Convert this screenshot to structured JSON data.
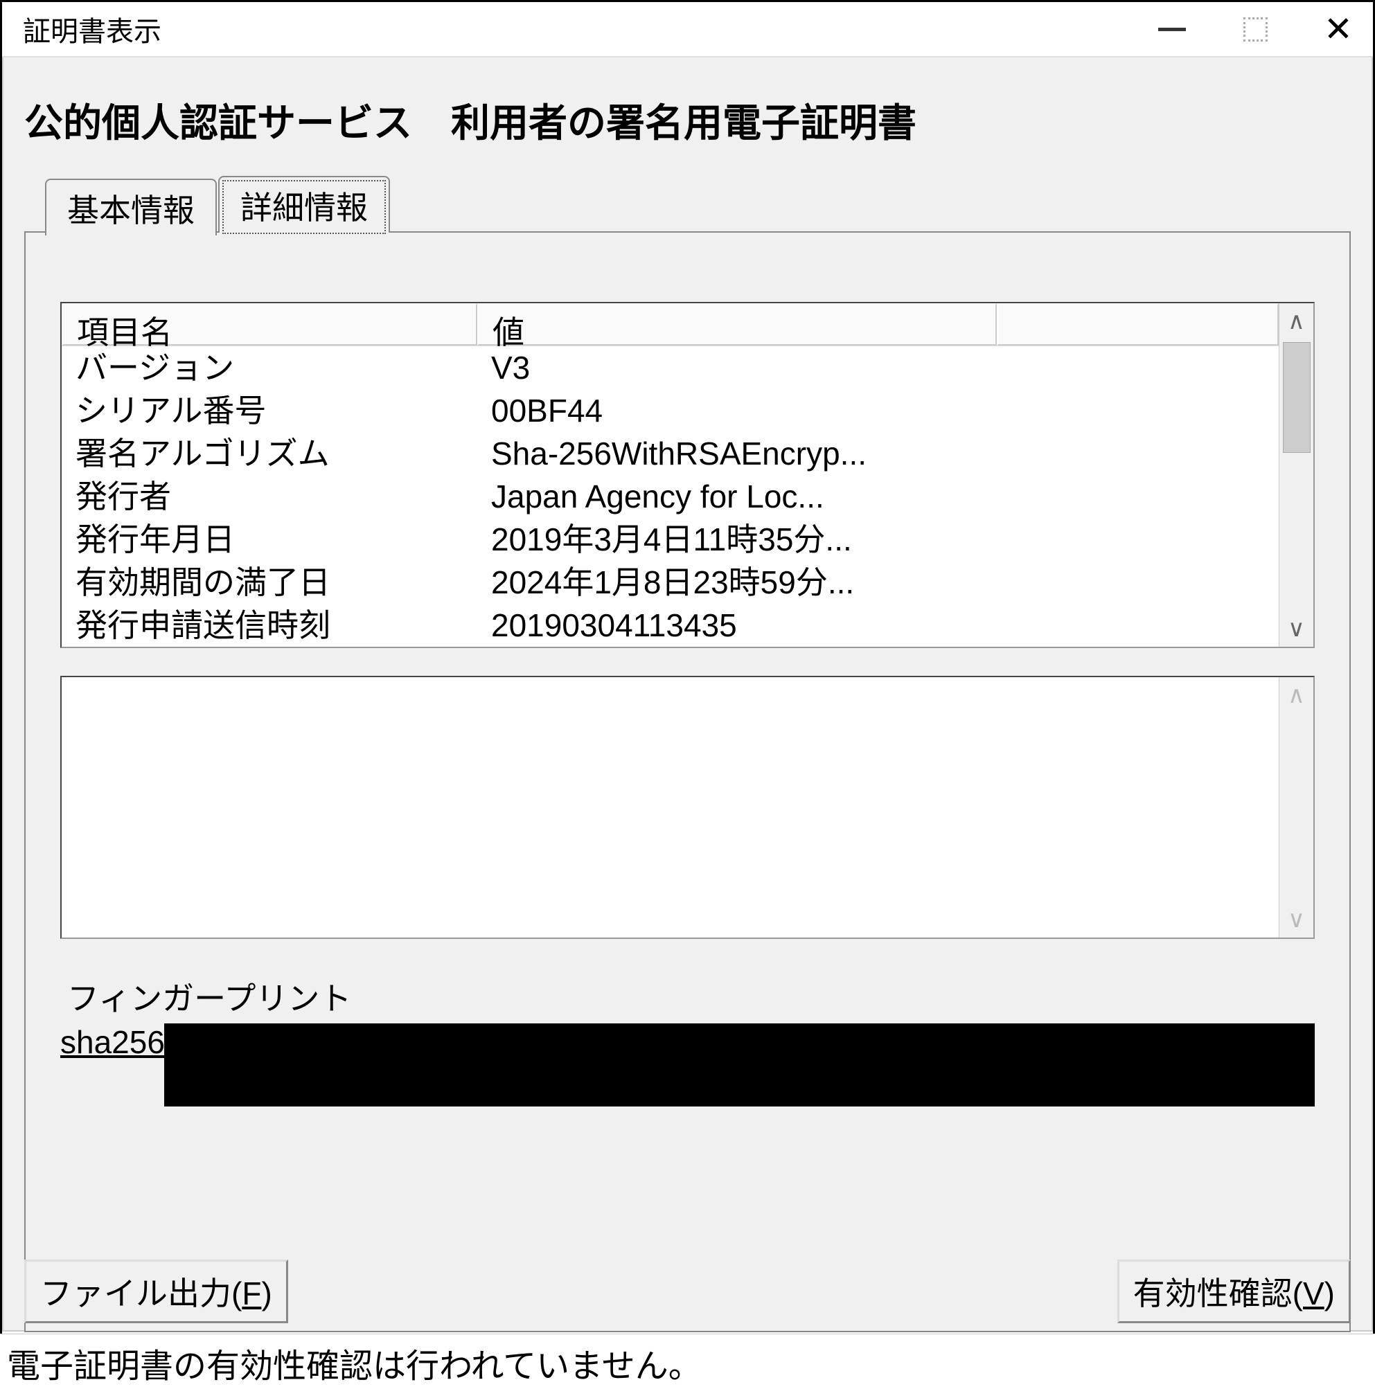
{
  "window": {
    "title": "証明書表示"
  },
  "heading": "公的個人認証サービス　利用者の署名用電子証明書",
  "tabs": {
    "basic": "基本情報",
    "detail": "詳細情報",
    "active": "detail"
  },
  "listview": {
    "headers": {
      "name": "項目名",
      "value": "値"
    },
    "rows": [
      {
        "name": "バージョン",
        "value": "V3"
      },
      {
        "name": "シリアル番号",
        "value": "00BF44"
      },
      {
        "name": "署名アルゴリズム",
        "value": "Sha-256WithRSAEncryp..."
      },
      {
        "name": "発行者",
        "value": "Japan Agency for Loc..."
      },
      {
        "name": "発行年月日",
        "value": "2019年3月4日11時35分..."
      },
      {
        "name": "有効期間の満了日",
        "value": "2024年1月8日23時59分..."
      },
      {
        "name": "発行申請送信時刻",
        "value": "20190304113435"
      }
    ]
  },
  "fingerprint": {
    "label": "フィンガープリント",
    "hash_prefix": "sha256"
  },
  "buttons": {
    "file_out": "ファイル出力(",
    "file_out_mn": "F",
    "file_out_end": ")",
    "validity": "有効性確認(",
    "validity_mn": "V",
    "validity_end": ")"
  },
  "status": "電子証明書の有効性確認は行われていません。"
}
